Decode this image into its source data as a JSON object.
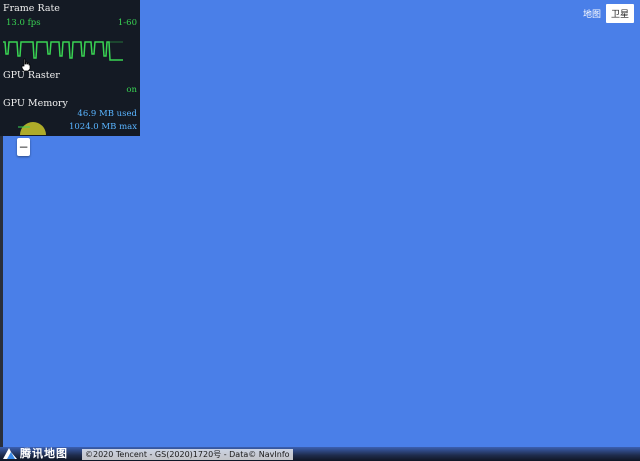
{
  "hud": {
    "frame_rate_title": "Frame Rate",
    "fps_value": "13.0 fps",
    "fps_range": "1-60",
    "gpu_raster_title": "GPU Raster",
    "gpu_raster_value": "on",
    "gpu_memory_title": "GPU Memory",
    "memory_used": "46.9 MB used",
    "memory_max": "1024.0 MB max"
  },
  "controls": {
    "zoom_out_label": "−"
  },
  "map_type": {
    "map_label": "地图",
    "satellite_label": "卫星"
  },
  "footer": {
    "logo_text": "腾讯地图",
    "copyright": "©2020 Tencent - GS(2020)1720号 - Data© NavInfo"
  },
  "colors": {
    "map_background": "#4a7fe8",
    "hud_background": "#141a24",
    "fps_green": "#39d353",
    "memory_blue": "#59b4ff"
  }
}
